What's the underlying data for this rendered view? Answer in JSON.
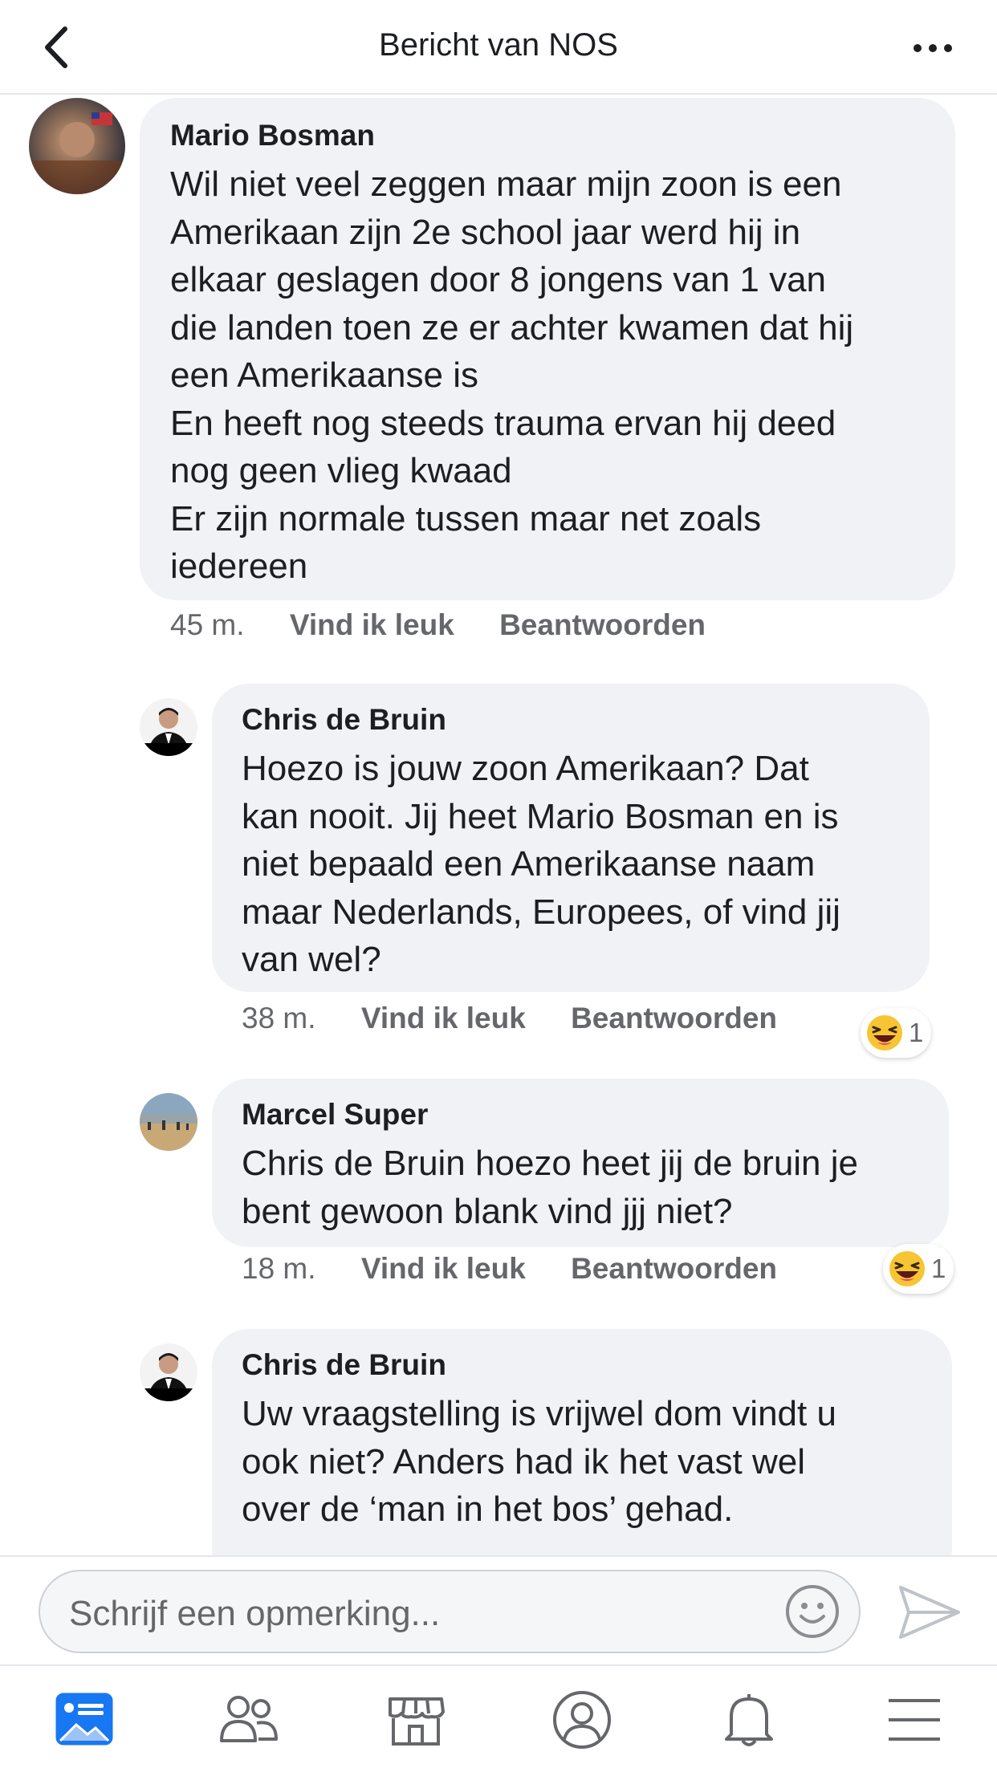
{
  "header": {
    "title": "Bericht van NOS",
    "back_icon": "chevron-left-icon",
    "more_icon": "more-dots-icon"
  },
  "comments": [
    {
      "author": "Mario Bosman",
      "lines": [
        "Wil niet veel zeggen maar mijn zoon is een",
        "Amerikaan zijn 2e school jaar werd hij in",
        "elkaar geslagen door 8 jongens van 1 van",
        "die landen toen ze er achter kwamen dat hij",
        "een Amerikaanse is",
        "En heeft nog steeds trauma ervan hij deed",
        "nog geen vlieg kwaad",
        "Er zijn normale tussen maar net zoals",
        "iedereen"
      ],
      "time": "45 m.",
      "like": "Vind ik leuk",
      "reply": "Beantwoorden"
    },
    {
      "author": "Chris de Bruin",
      "lines": [
        "Hoezo  is jouw zoon Amerikaan? Dat",
        "kan nooit. Jij heet Mario Bosman en is",
        "niet bepaald een Amerikaanse naam",
        "maar Nederlands, Europees, of vind jij",
        "van wel?"
      ],
      "time": "38 m.",
      "like": "Vind ik leuk",
      "reply": "Beantwoorden",
      "reaction": {
        "icon": "haha-emoji-icon",
        "count": "1"
      }
    },
    {
      "author": "Marcel Super",
      "lines": [
        "Chris de Bruin hoezo heet jij de bruin je",
        "bent gewoon blank vind jjj niet?"
      ],
      "time": "18 m.",
      "like": "Vind ik leuk",
      "reply": "Beantwoorden",
      "reaction": {
        "icon": "haha-emoji-icon",
        "count": "1"
      }
    },
    {
      "author": "Chris de Bruin",
      "lines": [
        "Uw vraagstelling is vrijwel dom vindt u",
        "ook niet? Anders had ik het vast wel",
        "over de ‘man in het bos’ gehad."
      ]
    }
  ],
  "composer": {
    "placeholder": "Schrijf een opmerking...",
    "emoji_icon": "smiley-icon",
    "send_icon": "send-icon"
  },
  "tabbar": {
    "items": [
      "news-feed-icon",
      "friends-icon",
      "marketplace-icon",
      "profile-icon",
      "notifications-bell-icon",
      "menu-icon"
    ],
    "active": "news-feed-icon",
    "active_color": "#1877f2",
    "inactive_color": "#65676b"
  }
}
